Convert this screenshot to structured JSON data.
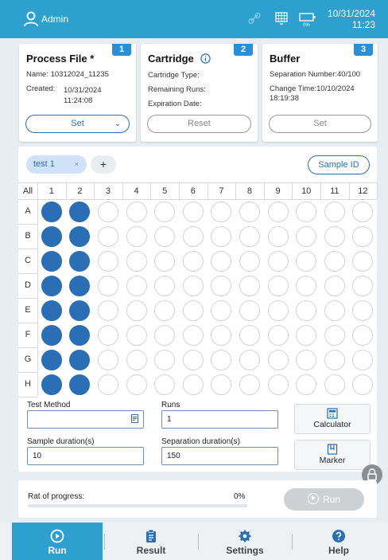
{
  "header": {
    "user": "Admin",
    "date": "10/31/2024",
    "time": "11:23",
    "battery_label": "0%"
  },
  "cards": {
    "process_file": {
      "number": "1",
      "title": "Process File *",
      "name_line": "Name: 10312024_11235",
      "created_label": "Created:",
      "created_date": "10/31/2024",
      "created_time": "11:24:08",
      "button": "Set"
    },
    "cartridge": {
      "number": "2",
      "title": "Cartridge",
      "type_line": "Cartridge Type:",
      "runs_line": "Remaining Runs:",
      "expiry_line": "Expiration Date:",
      "button": "Reset"
    },
    "buffer": {
      "number": "3",
      "title": "Buffer",
      "separation_line": "Separation Number:40/100",
      "change_line": "Change Time:10/10/2024",
      "change_time": "18:19:38",
      "button": "Set"
    }
  },
  "plate": {
    "tab_label": "test 1",
    "tab_close": "×",
    "add_label": "+",
    "sample_id_button": "Sample ID",
    "all_label": "All",
    "columns": [
      "1",
      "2",
      "3",
      "4",
      "5",
      "6",
      "7",
      "8",
      "9",
      "10",
      "11",
      "12"
    ],
    "rows": [
      "A",
      "B",
      "C",
      "D",
      "E",
      "F",
      "G",
      "H"
    ],
    "filled_columns": [
      1,
      2
    ]
  },
  "form": {
    "test_method_label": "Test Method",
    "test_method_value": "",
    "runs_label": "Runs",
    "runs_value": "1",
    "sample_duration_label": "Sample duration(s)",
    "sample_duration_value": "10",
    "separation_duration_label": "Separation duration(s)",
    "separation_duration_value": "150",
    "calculator_label": "Calculator",
    "marker_label": "Marker"
  },
  "progress": {
    "label": "Rat of progress:",
    "value_text": "0%",
    "fraction": 0,
    "run_button": "Run"
  },
  "nav": {
    "run": "Run",
    "result": "Result",
    "settings": "Settings",
    "help": "Help"
  },
  "colors": {
    "header_blue": "#2ea0cf",
    "accent_blue": "#2a6fb5",
    "badge_blue": "#2a8fd6",
    "disabled_gray": "#cdd1d4"
  }
}
